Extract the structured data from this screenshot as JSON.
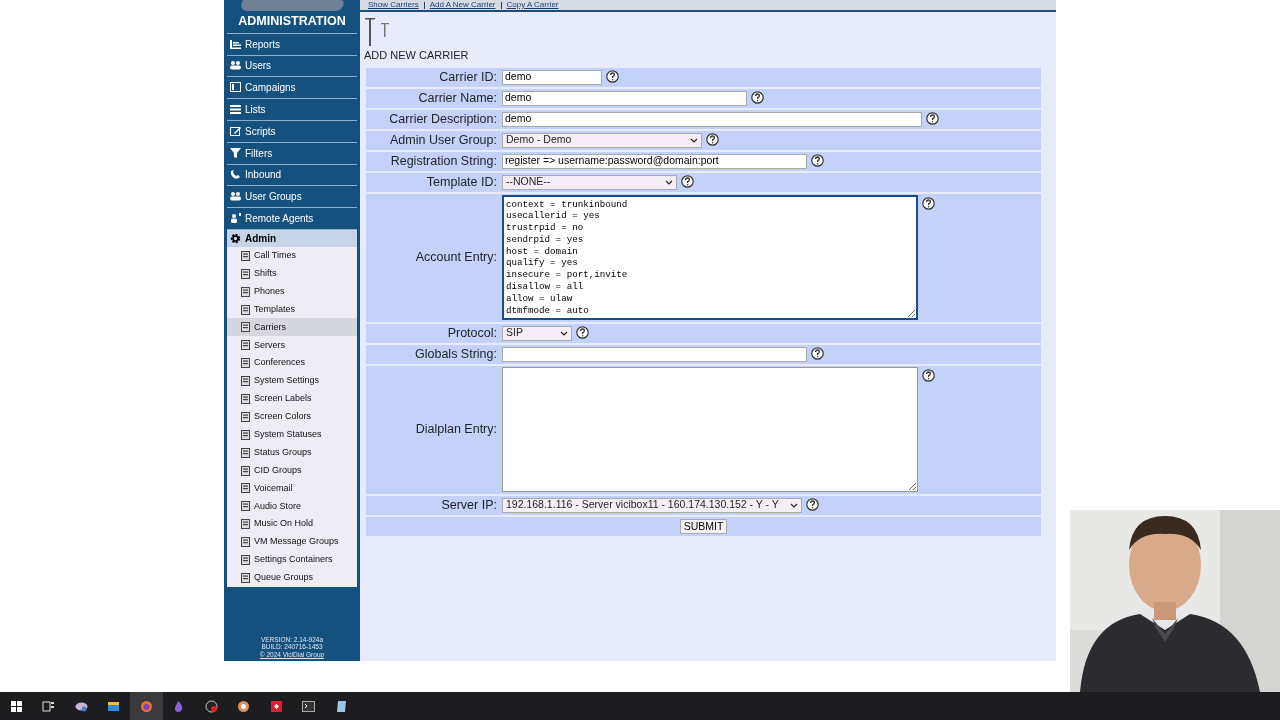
{
  "sidebar": {
    "header": "ADMINISTRATION",
    "items": [
      {
        "label": "Reports",
        "expanded": false
      },
      {
        "label": "Users",
        "expanded": false
      },
      {
        "label": "Campaigns",
        "expanded": false
      },
      {
        "label": "Lists",
        "expanded": false
      },
      {
        "label": "Scripts",
        "expanded": false
      },
      {
        "label": "Filters",
        "expanded": false
      },
      {
        "label": "Inbound",
        "expanded": false
      },
      {
        "label": "User Groups",
        "expanded": false
      },
      {
        "label": "Remote Agents",
        "expanded": false
      },
      {
        "label": "Admin",
        "expanded": true,
        "children": [
          {
            "label": "Call Times",
            "selected": false
          },
          {
            "label": "Shifts",
            "selected": false
          },
          {
            "label": "Phones",
            "selected": false
          },
          {
            "label": "Templates",
            "selected": false
          },
          {
            "label": "Carriers",
            "selected": true
          },
          {
            "label": "Servers",
            "selected": false
          },
          {
            "label": "Conferences",
            "selected": false
          },
          {
            "label": "System Settings",
            "selected": false
          },
          {
            "label": "Screen Labels",
            "selected": false
          },
          {
            "label": "Screen Colors",
            "selected": false
          },
          {
            "label": "System Statuses",
            "selected": false
          },
          {
            "label": "Status Groups",
            "selected": false
          },
          {
            "label": "CID Groups",
            "selected": false
          },
          {
            "label": "Voicemail",
            "selected": false
          },
          {
            "label": "Audio Store",
            "selected": false
          },
          {
            "label": "Music On Hold",
            "selected": false
          },
          {
            "label": "VM Message Groups",
            "selected": false
          },
          {
            "label": "Settings Containers",
            "selected": false
          },
          {
            "label": "Queue Groups",
            "selected": false
          }
        ]
      }
    ],
    "version": "VERSION: 2.14-924a",
    "build": "BUILD: 240716-1453",
    "copyright": "© 2024 ViciDial Group"
  },
  "links": [
    "Show Carriers",
    "Add A New Carrier",
    "Copy A Carrier"
  ],
  "heading": "ADD NEW CARRIER",
  "fields": [
    {
      "kind": "text",
      "label": "Carrier ID:",
      "value": "demo"
    },
    {
      "kind": "text",
      "label": "Carrier Name:",
      "value": "demo"
    },
    {
      "kind": "text",
      "label": "Carrier Description:",
      "value": "demo"
    },
    {
      "kind": "select",
      "label": "Admin User Group:",
      "value": "Demo - Demo"
    },
    {
      "kind": "text",
      "label": "Registration String:",
      "value": "register => username:password@domain:port"
    },
    {
      "kind": "select",
      "label": "Template ID:",
      "value": "--NONE--"
    },
    {
      "kind": "textarea",
      "label": "Account Entry:",
      "value": "context = trunkinbound\nusecallerid = yes\ntrustrpid = no\nsendrpid = yes\nhost = domain\nqualify = yes\ninsecure = port,invite\ndisallow = all\nallow = ulaw\ndtmfmode = auto"
    },
    {
      "kind": "select",
      "label": "Protocol:",
      "value": "SIP"
    },
    {
      "kind": "text",
      "label": "Globals String:"
    },
    {
      "kind": "textarea",
      "label": "Dialplan Entry:"
    },
    {
      "kind": "select",
      "label": "Server IP:",
      "value": "192.168.1.116 - Server vicibox11 - 160.174.130.152 - Y - Y"
    }
  ],
  "submit": "SUBMIT"
}
